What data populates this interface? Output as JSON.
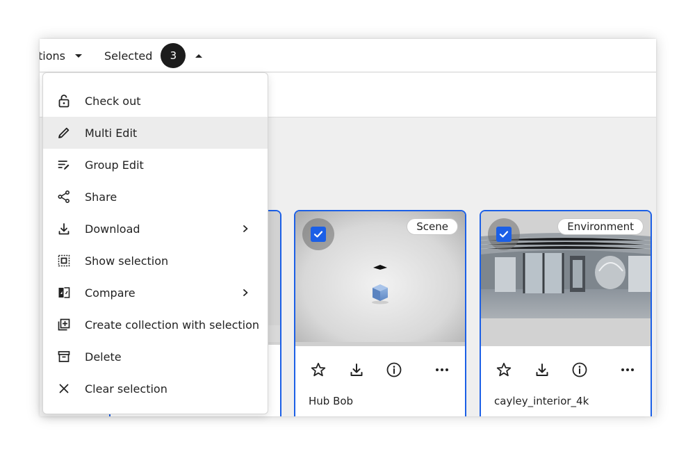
{
  "toolbar": {
    "actions_label": "tions",
    "selected_label": "Selected",
    "selected_count": "3"
  },
  "menu": {
    "items": [
      {
        "label": "Check out",
        "icon": "lock-open-icon"
      },
      {
        "label": "Multi Edit",
        "icon": "pencil-icon"
      },
      {
        "label": "Group Edit",
        "icon": "group-edit-icon"
      },
      {
        "label": "Share",
        "icon": "share-icon"
      },
      {
        "label": "Download",
        "icon": "download-icon",
        "submenu": true
      },
      {
        "label": "Show selection",
        "icon": "show-selection-icon"
      },
      {
        "label": "Compare",
        "icon": "compare-icon",
        "submenu": true
      },
      {
        "label": "Create collection with selection",
        "icon": "add-collection-icon"
      },
      {
        "label": "Delete",
        "icon": "archive-icon"
      },
      {
        "label": "Clear selection",
        "icon": "close-icon"
      }
    ],
    "highlighted_index": 1
  },
  "cards": [
    {
      "name": "",
      "type": "",
      "selected": true
    },
    {
      "name": "Hub Bob",
      "type": "Scene",
      "selected": true
    },
    {
      "name": "cayley_interior_4k",
      "type": "Environment",
      "selected": true
    }
  ],
  "colors": {
    "accent": "#1b5fe6",
    "badge_bg": "#1c1c1c",
    "menu_highlight": "#ececec"
  }
}
